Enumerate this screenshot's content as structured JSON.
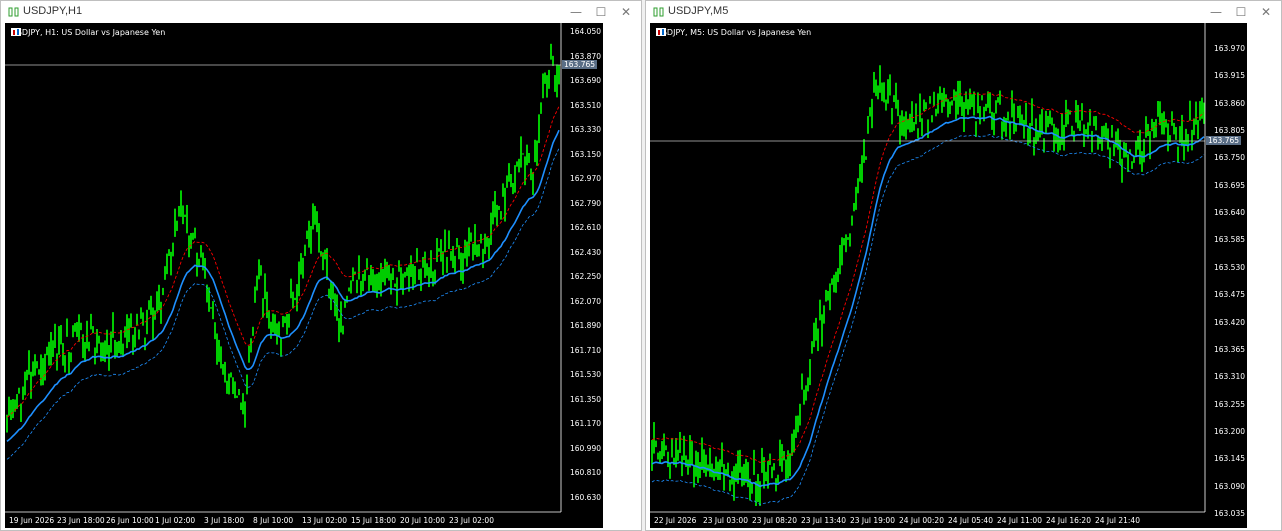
{
  "windows": [
    {
      "title": "USDJPY,H1",
      "label": "USDJPY, H1:  US Dollar vs Japanese Yen",
      "current_price": "163.765",
      "price_ticks": [
        "164.050",
        "163.870",
        "163.690",
        "163.510",
        "163.330",
        "163.150",
        "162.970",
        "162.790",
        "162.610",
        "162.430",
        "162.250",
        "162.070",
        "161.890",
        "161.710",
        "161.530",
        "161.350",
        "161.170",
        "160.990",
        "160.810",
        "160.630"
      ],
      "time_ticks": [
        "19 Jun 2026",
        "23 Jun 18:00",
        "26 Jun 10:00",
        "1 Jul 02:00",
        "3 Jul 18:00",
        "8 Jul 10:00",
        "13 Jul 02:00",
        "15 Jul 18:00",
        "20 Jul 10:00",
        "23 Jul 02:00"
      ]
    },
    {
      "title": "USDJPY,M5",
      "label": "USDJPY, M5:  US Dollar vs Japanese Yen",
      "current_price": "163.765",
      "price_ticks": [
        "163.970",
        "163.915",
        "163.860",
        "163.805",
        "163.750",
        "163.695",
        "163.640",
        "163.585",
        "163.530",
        "163.475",
        "163.420",
        "163.365",
        "163.310",
        "163.255",
        "163.200",
        "163.145",
        "163.090",
        "163.035"
      ],
      "time_ticks": [
        "22 Jul 2026",
        "23 Jul 03:00",
        "23 Jul 08:20",
        "23 Jul 13:40",
        "23 Jul 19:00",
        "24 Jul 00:20",
        "24 Jul 05:40",
        "24 Jul 11:00",
        "24 Jul 16:20",
        "24 Jul 21:40"
      ]
    }
  ],
  "buttons": {
    "minimize": "—",
    "maximize": "☐",
    "close": "✕"
  },
  "colors": {
    "candles": "#00ff00",
    "ma": "#1e90ff",
    "band_upper": "#ff0000",
    "band_lower": "#1e90ff",
    "background": "#000000",
    "grid_line": "#c0c0c0"
  }
}
